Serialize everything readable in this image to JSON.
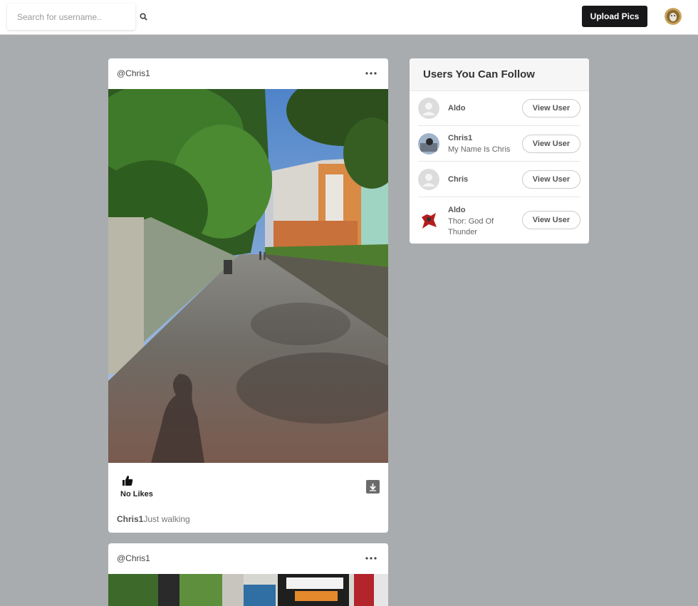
{
  "navbar": {
    "search_placeholder": "Search for username..",
    "search_icon": "search-icon",
    "upload_label": "Upload Pics",
    "avatar_icon": "user-avatar"
  },
  "feed": {
    "posts": [
      {
        "username": "@Chris1",
        "likes_text": "No Likes",
        "caption_user": "Chris1",
        "caption_text": "Just walking"
      },
      {
        "username": "@Chris1"
      }
    ]
  },
  "suggestions": {
    "title": "Users You Can Follow",
    "button_label": "View User",
    "users": [
      {
        "name": "Aldo",
        "bio": ""
      },
      {
        "name": "Chris1",
        "bio": "My Name Is Chris"
      },
      {
        "name": "Chris",
        "bio": ""
      },
      {
        "name": "Aldo",
        "bio": "Thor: God Of Thunder"
      }
    ]
  },
  "colors": {
    "page_background": "#a9acaf",
    "upload_button": "#18181b",
    "card_background": "#ffffff"
  }
}
